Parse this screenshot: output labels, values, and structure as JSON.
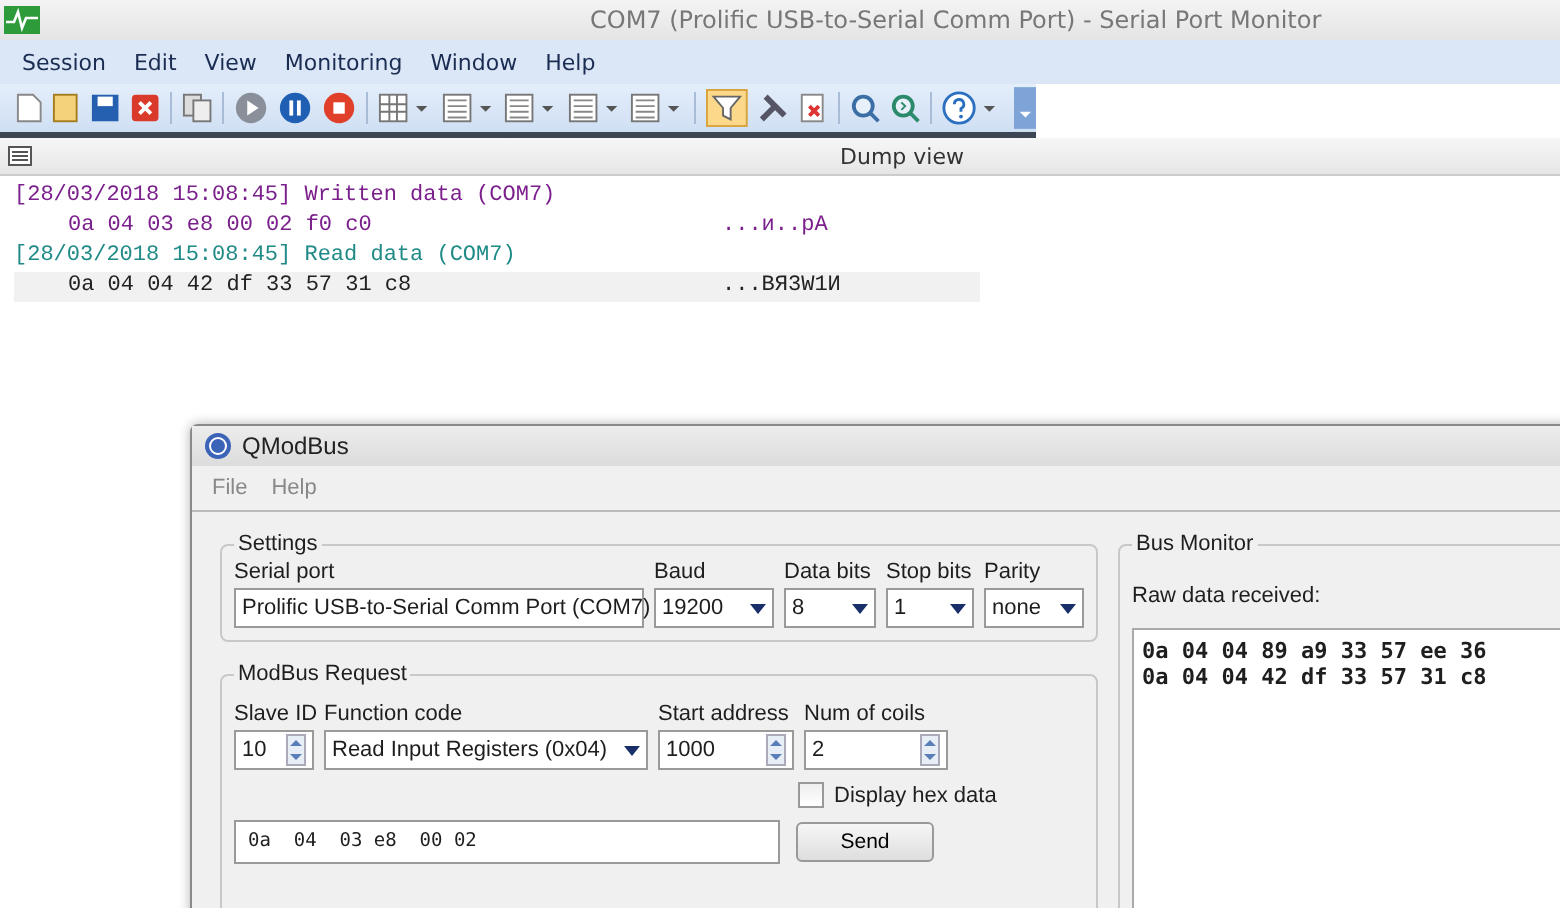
{
  "window": {
    "title": "COM7 (Prolific USB-to-Serial Comm Port) - Serial Port Monitor"
  },
  "menu": [
    "Session",
    "Edit",
    "View",
    "Monitoring",
    "Window",
    "Help"
  ],
  "dump_view": {
    "title": "Dump view",
    "lines": [
      {
        "kind": "header",
        "color": "#7b1f8c",
        "text": "[28/03/2018 15:08:45] Written data (COM7)"
      },
      {
        "kind": "data",
        "color": "#7b1f8c",
        "hex": "0a 04 03 e8 00 02 f0 c0",
        "ascii": "...и..pА",
        "selected": false
      },
      {
        "kind": "header",
        "color": "#1f8a86",
        "text": "[28/03/2018 15:08:45] Read data (COM7)"
      },
      {
        "kind": "data",
        "color": "#222222",
        "hex": "0a 04 04 42 df 33 57 31 c8",
        "ascii": "...BЯ3W1И",
        "selected": true
      }
    ]
  },
  "qmodbus": {
    "title": "QModBus",
    "menu": [
      "File",
      "Help"
    ],
    "settings": {
      "title": "Settings",
      "fields": [
        {
          "label": "Serial port",
          "value": "Prolific USB-to-Serial Comm Port (COM7)",
          "kind": "combo"
        },
        {
          "label": "Baud",
          "value": "19200",
          "kind": "combo"
        },
        {
          "label": "Data bits",
          "value": "8",
          "kind": "combo"
        },
        {
          "label": "Stop bits",
          "value": "1",
          "kind": "combo"
        },
        {
          "label": "Parity",
          "value": "none",
          "kind": "combo"
        }
      ]
    },
    "request": {
      "title": "ModBus Request",
      "fields": [
        {
          "label": "Slave ID",
          "value": "10",
          "kind": "spin"
        },
        {
          "label": "Function code",
          "value": "Read Input Registers (0x04)",
          "kind": "combo"
        },
        {
          "label": "Start address",
          "value": "1000",
          "kind": "spin"
        },
        {
          "label": "Num of coils",
          "value": "2",
          "kind": "spin"
        }
      ],
      "display_hex": {
        "label": "Display hex data",
        "checked": false
      },
      "raw_request": "0a  04  03 e8  00 02",
      "send_button": "Send"
    },
    "bus_monitor": {
      "title": "Bus Monitor",
      "label": "Raw data received:",
      "lines": [
        "0a 04 04 89 a9 33 57 ee 36",
        "0a 04 04 42 df 33 57 31 c8"
      ]
    }
  }
}
